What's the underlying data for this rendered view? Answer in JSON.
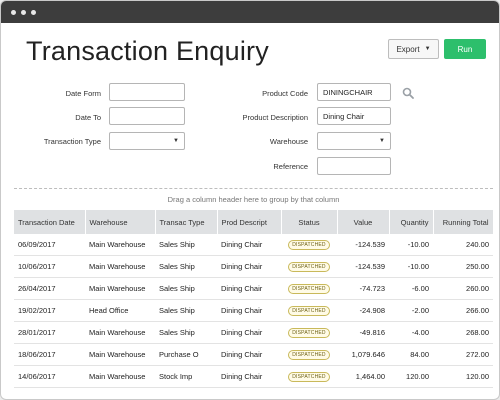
{
  "page": {
    "title": "Transaction Enquiry"
  },
  "toolbar": {
    "export_label": "Export",
    "run_label": "Run"
  },
  "filters": {
    "date_from_label": "Date Form",
    "date_to_label": "Date To",
    "transaction_type_label": "Transaction Type",
    "product_code_label": "Product Code",
    "product_code_value": "DININGCHAIR",
    "product_description_label": "Product Description",
    "product_description_value": "Dining Chair",
    "warehouse_label": "Warehouse",
    "reference_label": "Reference"
  },
  "grid": {
    "group_hint": "Drag a column header here to group by that column",
    "columns": [
      "Transaction Date",
      "Warehouse",
      "Transac Type",
      "Prod Descript",
      "Status",
      "Value",
      "Quantity",
      "Running Total"
    ],
    "rows": [
      [
        "06/09/2017",
        "Main Warehouse",
        "Sales Ship",
        "Dining Chair",
        "DISPATCHED",
        "-124.539",
        "-10.00",
        "240.00"
      ],
      [
        "10/06/2017",
        "Main Warehouse",
        "Sales Ship",
        "Dining Chair",
        "DISPATCHED",
        "-124.539",
        "-10.00",
        "250.00"
      ],
      [
        "26/04/2017",
        "Main Warehouse",
        "Sales Ship",
        "Dining Chair",
        "DISPATCHED",
        "-74.723",
        "-6.00",
        "260.00"
      ],
      [
        "19/02/2017",
        "Head Office",
        "Sales Ship",
        "Dining Chair",
        "DISPATCHED",
        "-24.908",
        "-2.00",
        "266.00"
      ],
      [
        "28/01/2017",
        "Main Warehouse",
        "Sales Ship",
        "Dining Chair",
        "DISPATCHED",
        "-49.816",
        "-4.00",
        "268.00"
      ],
      [
        "18/06/2017",
        "Main Warehouse",
        "Purchase O",
        "Dining Chair",
        "DISPATCHED",
        "1,079.646",
        "84.00",
        "272.00"
      ],
      [
        "14/06/2017",
        "Main Warehouse",
        "Stock Imp",
        "Dining Chair",
        "DISPATCHED",
        "1,464.00",
        "120.00",
        "120.00"
      ]
    ]
  },
  "colors": {
    "run_button": "#2dbf6c",
    "link": "#2a7ab6",
    "header_bg": "#dfe1e3"
  },
  "icons": {
    "search": "search-icon",
    "dropdown": "chevron-down-icon"
  }
}
